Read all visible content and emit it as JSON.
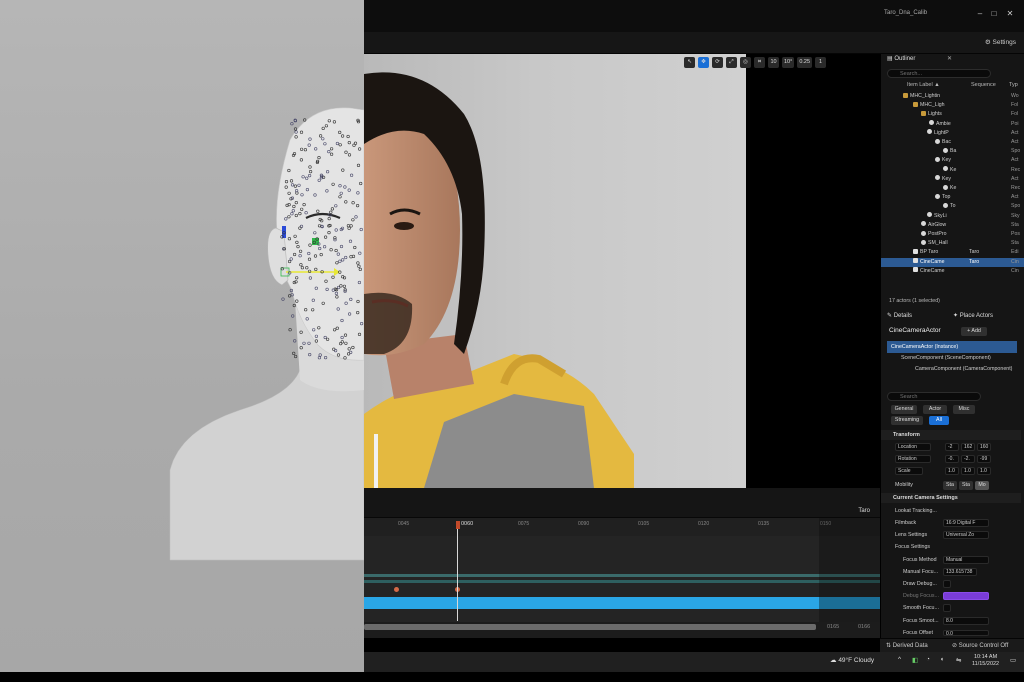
{
  "window": {
    "title": "Taro_Dna_Calib",
    "minimize": "–",
    "maximize": "□",
    "close": "✕",
    "settings_label": "Settings"
  },
  "viewport": {
    "toolbar": [
      "10",
      "10°",
      "0.25",
      "1"
    ]
  },
  "sequencer": {
    "track_name": "Taro",
    "current_frame": "0060",
    "ticks": [
      "0045",
      "0075",
      "0090",
      "0105",
      "0120",
      "0135",
      "0150"
    ],
    "end_frames": [
      "0165",
      "0166"
    ]
  },
  "outliner": {
    "tab_label": "Outliner",
    "search_placeholder": "Search...",
    "columns": {
      "label": "Item Label ▲",
      "sequence": "Sequence",
      "type": "Typ"
    },
    "rows": [
      {
        "indent": 22,
        "icon": "folder",
        "label": "MHC_Lightin",
        "seq": "",
        "type": "Wo"
      },
      {
        "indent": 32,
        "icon": "folder",
        "label": "MHC_Ligh",
        "seq": "",
        "type": "Fol"
      },
      {
        "indent": 40,
        "icon": "folder",
        "label": "Lights",
        "seq": "",
        "type": "Fol"
      },
      {
        "indent": 48,
        "icon": "light",
        "label": "Ambie",
        "seq": "",
        "type": "Poi"
      },
      {
        "indent": 46,
        "icon": "light",
        "label": "LightP",
        "seq": "",
        "type": "Act"
      },
      {
        "indent": 54,
        "icon": "light",
        "label": "Bac",
        "seq": "",
        "type": "Act"
      },
      {
        "indent": 62,
        "icon": "light",
        "label": "Ba",
        "seq": "",
        "type": "Spo"
      },
      {
        "indent": 54,
        "icon": "light",
        "label": "Key",
        "seq": "",
        "type": "Act"
      },
      {
        "indent": 62,
        "icon": "light",
        "label": "Ke",
        "seq": "",
        "type": "Rec"
      },
      {
        "indent": 54,
        "icon": "light",
        "label": "Key",
        "seq": "",
        "type": "Act"
      },
      {
        "indent": 62,
        "icon": "light",
        "label": "Ke",
        "seq": "",
        "type": "Rec"
      },
      {
        "indent": 54,
        "icon": "light",
        "label": "Top",
        "seq": "",
        "type": "Act"
      },
      {
        "indent": 62,
        "icon": "light",
        "label": "To",
        "seq": "",
        "type": "Spo"
      },
      {
        "indent": 46,
        "icon": "light",
        "label": "SkyLi",
        "seq": "",
        "type": "Sky"
      },
      {
        "indent": 40,
        "icon": "light",
        "label": "AirGlow",
        "seq": "",
        "type": "Sta"
      },
      {
        "indent": 40,
        "icon": "light",
        "label": "PostPro",
        "seq": "",
        "type": "Pos"
      },
      {
        "indent": 40,
        "icon": "light",
        "label": "SM_Hall",
        "seq": "",
        "type": "Sta"
      },
      {
        "indent": 32,
        "icon": "cam",
        "label": "BP Taro",
        "seq": "Taro",
        "type": "Edi"
      },
      {
        "indent": 32,
        "icon": "cam",
        "label": "CineCame",
        "seq": "Taro",
        "type": "Cin",
        "selected": true
      },
      {
        "indent": 32,
        "icon": "cam",
        "label": "CineCame",
        "seq": "",
        "type": "Cin"
      }
    ],
    "footer": "17 actors (1 selected)"
  },
  "details": {
    "tab_label": "Details",
    "place_actors_label": "Place Actors",
    "actor_name": "CineCameraActor",
    "add_label": "+ Add",
    "components": [
      "CineCameraActor (Instance)",
      "SceneComponent (SceneComponent)",
      "CameraComponent (CameraComponent)"
    ],
    "search_placeholder": "Search",
    "filters": [
      "General",
      "Actor",
      "Misc",
      "Streaming",
      "All"
    ],
    "transform_label": "Transform",
    "location_label": "Location",
    "rotation_label": "Rotation",
    "scale_label": "Scale",
    "location": [
      "-2",
      "162",
      "160"
    ],
    "rotation": [
      "-0.",
      "-2.",
      "-99"
    ],
    "scale": [
      "1.0",
      "1.0",
      "1.0"
    ],
    "mobility_label": "Mobility",
    "mobility_opts": [
      "Sta",
      "Sta",
      "Mo"
    ],
    "camera_settings_label": "Current Camera Settings",
    "lookat_label": "Lookat Tracking...",
    "filmback_label": "Filmback",
    "filmback_value": "16:9 Digital F",
    "lens_label": "Lens Settings",
    "lens_value": "Universal Zo",
    "focus_label": "Focus Settings",
    "focus_method_label": "Focus Method",
    "focus_method_value": "Manual",
    "manual_focus_label": "Manual Focu...",
    "manual_focus_value": "133.615738",
    "draw_debug_label": "Draw Debug...",
    "debug_focus_label": "Debug Focus...",
    "smooth_focus_label": "Smooth Focu...",
    "focus_smooth_label": "Focus Smoot...",
    "focus_smooth_value": "8.0",
    "focus_offset_label": "Focus Offset",
    "focus_offset_value": "0.0"
  },
  "status": {
    "derived_data": "Derived Data",
    "source_control": "Source Control Off"
  },
  "taskbar": {
    "weather": "49°F  Cloudy",
    "time": "10:14 AM",
    "date": "11/15/2022"
  }
}
